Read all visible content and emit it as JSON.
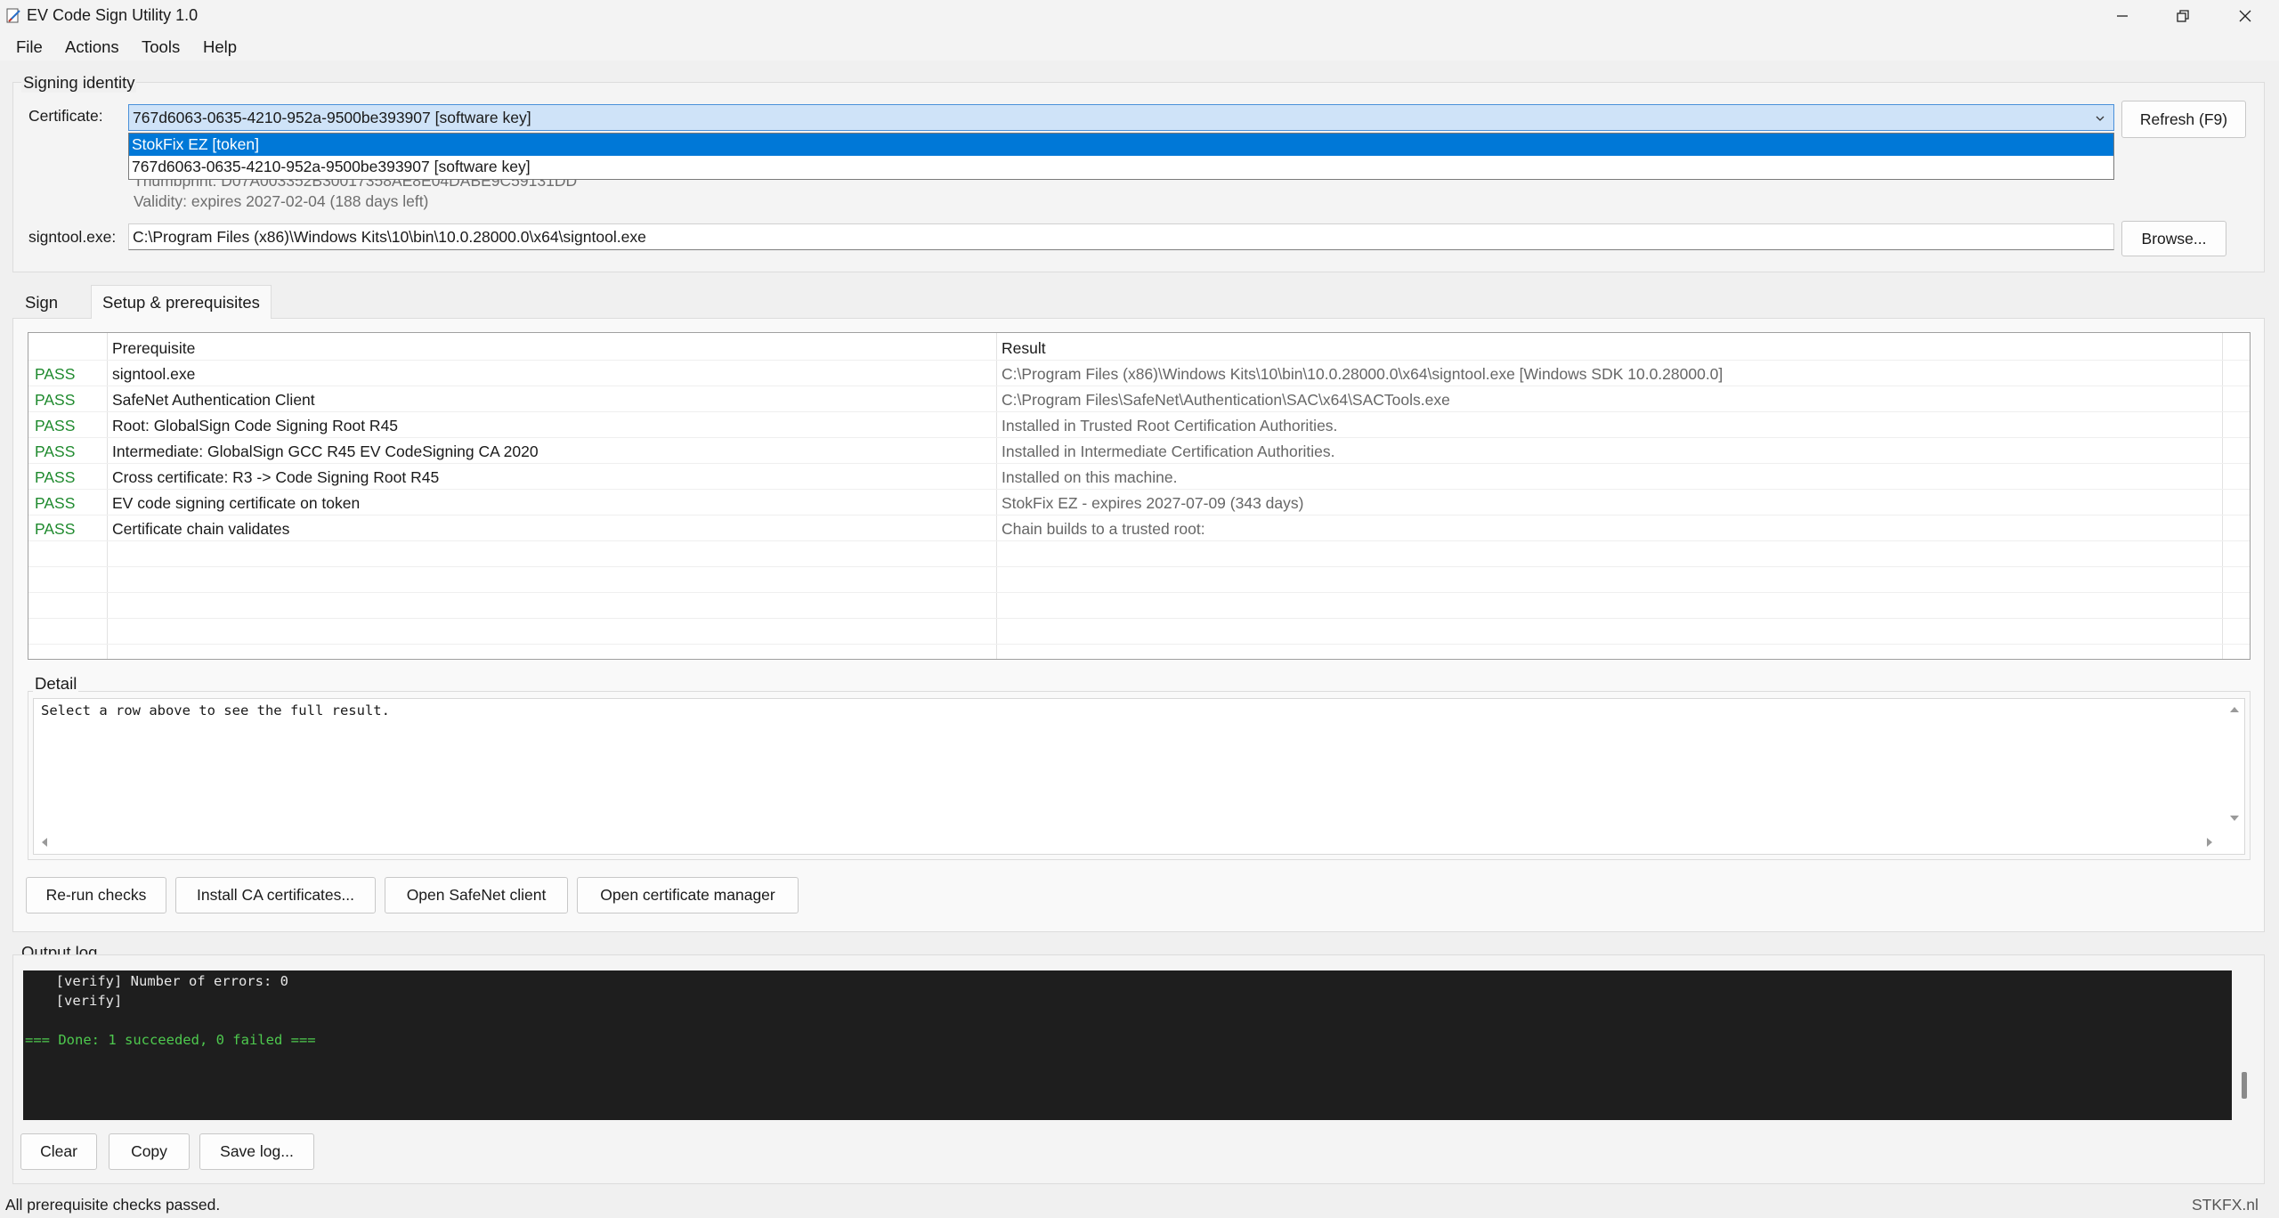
{
  "window": {
    "title": "EV Code Sign Utility 1.0"
  },
  "menu": [
    "File",
    "Actions",
    "Tools",
    "Help"
  ],
  "signing_identity": {
    "group_title": "Signing identity",
    "certificate_label": "Certificate:",
    "certificate_value": "767d6063-0635-4210-952a-9500be393907  [software key]",
    "dropdown_options": [
      "StokFix EZ  [token]",
      "767d6063-0635-4210-952a-9500be393907  [software key]"
    ],
    "dropdown_highlighted": "StokFix EZ  [token]",
    "refresh_label": "Refresh (F9)",
    "thumbprint_partial": "Thumbprint:  D07A003352B30017358AE8E04DABE9C59131DD",
    "validity": "Validity:  expires 2027-02-04 (188 days left)",
    "signtool_label": "signtool.exe:",
    "signtool_path": "C:\\Program Files (x86)\\Windows Kits\\10\\bin\\10.0.28000.0\\x64\\signtool.exe",
    "browse_label": "Browse..."
  },
  "tabs": [
    "Sign",
    "Setup & prerequisites"
  ],
  "active_tab": "Setup & prerequisites",
  "prereq_table": {
    "headers": [
      "Prerequisite",
      "Result"
    ],
    "rows": [
      {
        "status": "PASS",
        "prerequisite": "signtool.exe",
        "result": "C:\\Program Files (x86)\\Windows Kits\\10\\bin\\10.0.28000.0\\x64\\signtool.exe  [Windows SDK 10.0.28000.0]"
      },
      {
        "status": "PASS",
        "prerequisite": "SafeNet Authentication Client",
        "result": "C:\\Program Files\\SafeNet\\Authentication\\SAC\\x64\\SACTools.exe"
      },
      {
        "status": "PASS",
        "prerequisite": "Root: GlobalSign Code Signing Root R45",
        "result": "Installed in Trusted Root Certification Authorities."
      },
      {
        "status": "PASS",
        "prerequisite": "Intermediate: GlobalSign GCC R45 EV CodeSigning CA 2020",
        "result": "Installed in Intermediate Certification Authorities."
      },
      {
        "status": "PASS",
        "prerequisite": "Cross certificate: R3 -> Code Signing Root R45",
        "result": "Installed on this machine."
      },
      {
        "status": "PASS",
        "prerequisite": "EV code signing certificate on token",
        "result": "StokFix EZ - expires 2027-07-09 (343 days)"
      },
      {
        "status": "PASS",
        "prerequisite": "Certificate chain validates",
        "result": "Chain builds to a trusted root:"
      }
    ]
  },
  "detail": {
    "title": "Detail",
    "text": "Select a row above to see the full result."
  },
  "actions": {
    "rerun": "Re-run checks",
    "install_ca": "Install CA certificates...",
    "open_safenet": "Open SafeNet client",
    "open_certmgr": "Open certificate manager"
  },
  "output_log": {
    "title": "Output log",
    "lines": [
      "  [verify] Number of errors: 0",
      "  [verify]",
      "",
      "=== Done: 1 succeeded, 0 failed ==="
    ],
    "clear": "Clear",
    "copy": "Copy",
    "save": "Save log..."
  },
  "status": {
    "message": "All prerequisite checks passed.",
    "brand": "STKFX.nl"
  },
  "colors": {
    "pass": "#1f8a2e",
    "selection": "#0078d7",
    "log_bg": "#1e1e1e",
    "log_done": "#4ec94e"
  }
}
